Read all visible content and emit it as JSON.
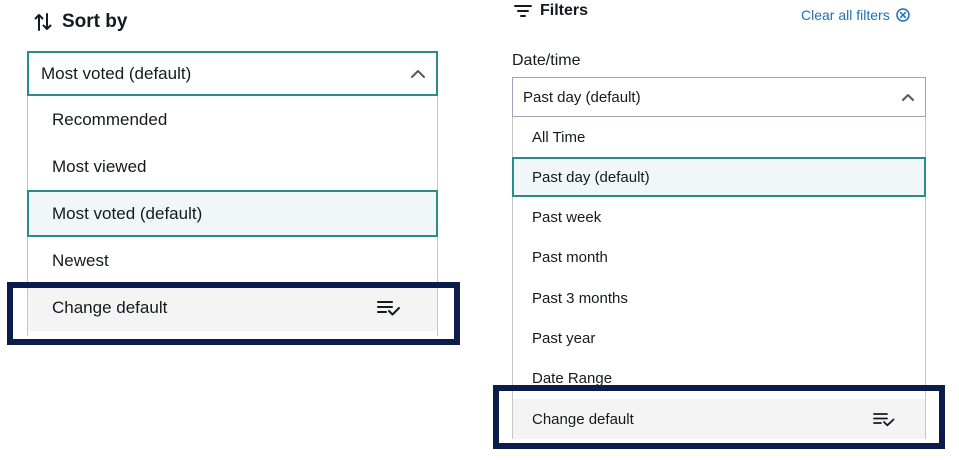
{
  "sort": {
    "title": "Sort by",
    "selected_value": "Most voted (default)",
    "options": [
      {
        "label": "Recommended"
      },
      {
        "label": "Most viewed"
      },
      {
        "label": "Most voted (default)"
      },
      {
        "label": "Newest"
      }
    ],
    "change_default": "Change default"
  },
  "filters": {
    "title": "Filters",
    "clear_all": "Clear all filters",
    "date_time": {
      "label": "Date/time",
      "selected_value": "Past day (default)",
      "options": [
        {
          "label": "All Time"
        },
        {
          "label": "Past day (default)"
        },
        {
          "label": "Past week"
        },
        {
          "label": "Past month"
        },
        {
          "label": "Past 3 months"
        },
        {
          "label": "Past year"
        },
        {
          "label": "Date Range"
        }
      ],
      "change_default": "Change default"
    }
  },
  "colors": {
    "accent_teal": "#2a8a8c",
    "selected_bg": "#f1f7f8",
    "link_blue": "#1d6fb5",
    "highlight_navy": "#0d1d49"
  },
  "icons": {
    "sort": "sort-arrows-icon",
    "filter": "filter-lines-icon",
    "clear": "close-circle-icon",
    "chevron": "chevron-up-icon",
    "change_default": "list-check-icon"
  }
}
